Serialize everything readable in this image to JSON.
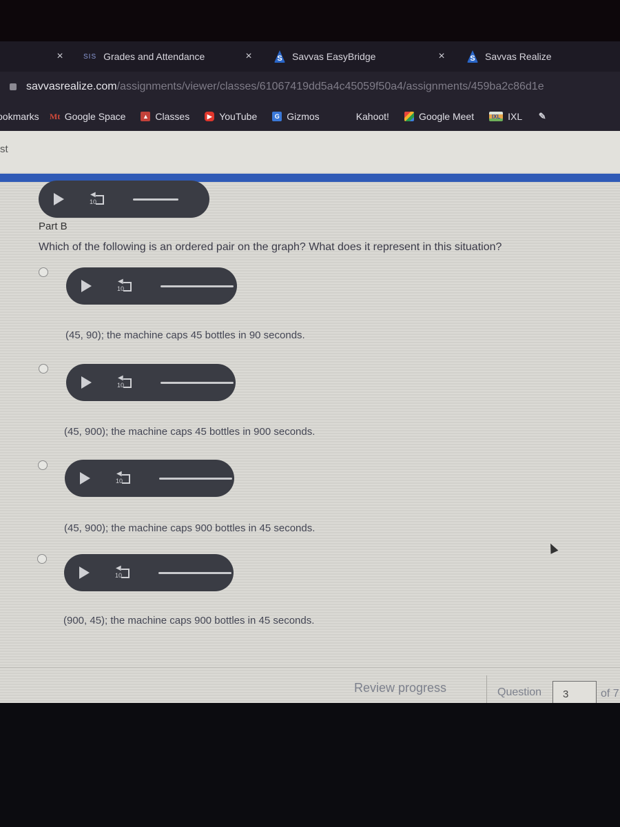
{
  "browser": {
    "tabs": [
      {
        "label": "",
        "close": "×"
      },
      {
        "label": "Grades and Attendance",
        "favicon": "sis-icon",
        "favicon_text": "SIS",
        "close": "×"
      },
      {
        "label": "Savvas EasyBridge",
        "favicon": "savvas-icon",
        "favicon_text": "S",
        "close": "×"
      },
      {
        "label": "Savvas Realize",
        "favicon": "savvas-icon",
        "favicon_text": "S"
      }
    ],
    "url": {
      "host": "savvasrealize.com",
      "path": "/assignments/viewer/classes/61067419dd5a4c45059f50a4/assignments/459ba2c86d1e"
    },
    "bookmarks": [
      {
        "label": "ookmarks"
      },
      {
        "label": "Google Space",
        "icon": "Mt"
      },
      {
        "label": "Classes",
        "icon": "classes-icon"
      },
      {
        "label": "YouTube",
        "icon": "youtube-icon",
        "icon_text": "▶"
      },
      {
        "label": "Gizmos",
        "icon": "gizmos-icon",
        "icon_text": "G"
      },
      {
        "label": "Kahoot!",
        "icon": "kahoot-icon"
      },
      {
        "label": "Google Meet",
        "icon": "google-meet-icon"
      },
      {
        "label": "IXL",
        "icon": "ixl-icon",
        "icon_text": "IXL"
      }
    ],
    "colors": {
      "tabstrip": "#1d1a24",
      "accent_band": "#2f5ab6"
    }
  },
  "page": {
    "header_label": "st",
    "part": "Part B",
    "prompt": "Which of the following is an ordered pair on the graph? What does it represent in this situation?",
    "audio": {
      "rewind_label": "10"
    },
    "choices": [
      {
        "text": "(45, 90); the machine caps 45 bottles in 90 seconds.",
        "selected": false
      },
      {
        "text": "(45, 900); the machine caps 45 bottles in 900 seconds.",
        "selected": false
      },
      {
        "text": "(45, 900); the machine caps 900 bottles in 45 seconds.",
        "selected": false
      },
      {
        "text": "(900, 45); the machine caps 900 bottles in 45 seconds.",
        "selected": false
      }
    ],
    "footer": {
      "review_label": "Review progress",
      "question_label": "Question",
      "question_value": "3",
      "of_label": "of 7"
    }
  }
}
